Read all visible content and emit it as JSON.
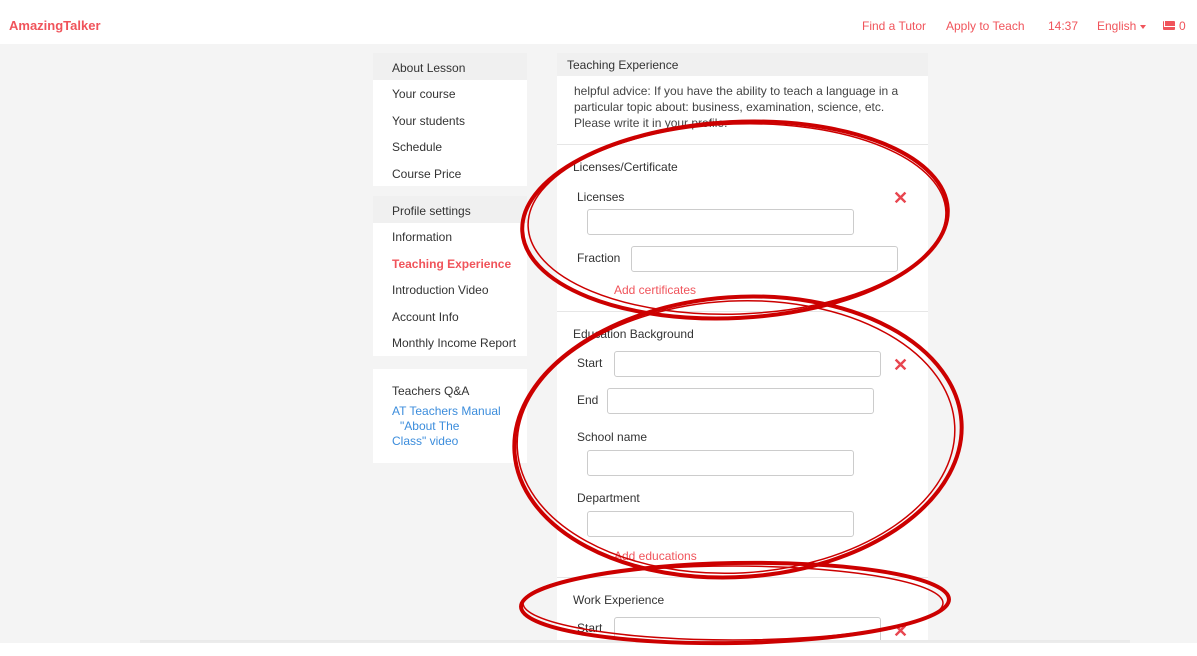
{
  "nav": {
    "brand": "AmazingTalker",
    "find_tutor": "Find a Tutor",
    "apply_teach": "Apply to Teach",
    "time": "14:37",
    "language": "English",
    "mail_count": "0"
  },
  "sidebar": {
    "lesson_head": "About Lesson",
    "lesson_items": [
      "Your course",
      "Your students",
      "Schedule",
      "Course Price"
    ],
    "profile_head": "Profile settings",
    "profile_items": [
      "Information",
      "Teaching Experience",
      "Introduction Video",
      "Account Info",
      "Monthly Income Report"
    ],
    "qa_title": "Teachers Q&A",
    "qa_links": [
      "AT Teachers Manual",
      "\"About The",
      "Class\" video"
    ]
  },
  "main": {
    "title": "Teaching Experience",
    "advice": "helpful advice: If you have the ability to teach a language in a particular topic about: business, examination, science, etc. Please write it in your profile.",
    "licenses": {
      "section": "Licenses/Certificate",
      "licenses_label": "Licenses",
      "fraction_label": "Fraction",
      "add": "Add certificates"
    },
    "education": {
      "section": "Education Background",
      "start_label": "Start",
      "end_label": "End",
      "school_label": "School name",
      "department_label": "Department",
      "add": "Add educations"
    },
    "work": {
      "section": "Work Experience",
      "start_label": "Start"
    }
  },
  "colors": {
    "accent": "#f0545b",
    "link": "#3c8ddc",
    "annotation": "#cc0000"
  }
}
